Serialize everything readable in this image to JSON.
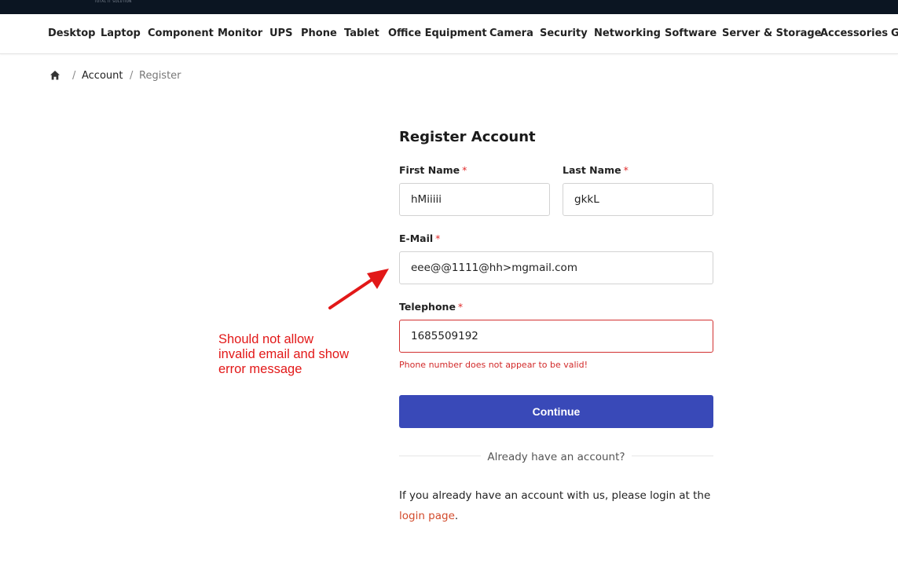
{
  "topbar": {
    "tagline": "TOTAL IT SOLUTION"
  },
  "nav": {
    "items": [
      "Desktop",
      "Laptop",
      "Component",
      "Monitor",
      "UPS",
      "Phone",
      "Tablet",
      "Office Equipment",
      "Camera",
      "Security",
      "Networking",
      "Software",
      "Server & Storage",
      "Accessories",
      "G"
    ]
  },
  "breadcrumb": {
    "home_icon": "home-icon",
    "sep": "/",
    "account": "Account",
    "current": "Register"
  },
  "form": {
    "title": "Register Account",
    "required_mark": "*",
    "first_name": {
      "label": "First Name",
      "value": "hMiiiii"
    },
    "last_name": {
      "label": "Last Name",
      "value": "gkkL"
    },
    "email": {
      "label": "E-Mail",
      "value": "eee@@1111@hh>mgmail.com"
    },
    "telephone": {
      "label": "Telephone",
      "value": "1685509192",
      "error": "Phone number does not appear to be valid!"
    },
    "continue_label": "Continue"
  },
  "login_section": {
    "divider_text": "Already have an account?",
    "text_before": "If you already have an account with us, please login at the ",
    "link_text": "login page",
    "text_after": "."
  },
  "annotation": {
    "line1": "Should not allow",
    "line2": "invalid email and show",
    "line3": "error message"
  },
  "colors": {
    "accent": "#3949b8",
    "error": "#d22a2a",
    "annotation": "#e21818",
    "link": "#d24a2b",
    "topbar": "#0b1522"
  }
}
